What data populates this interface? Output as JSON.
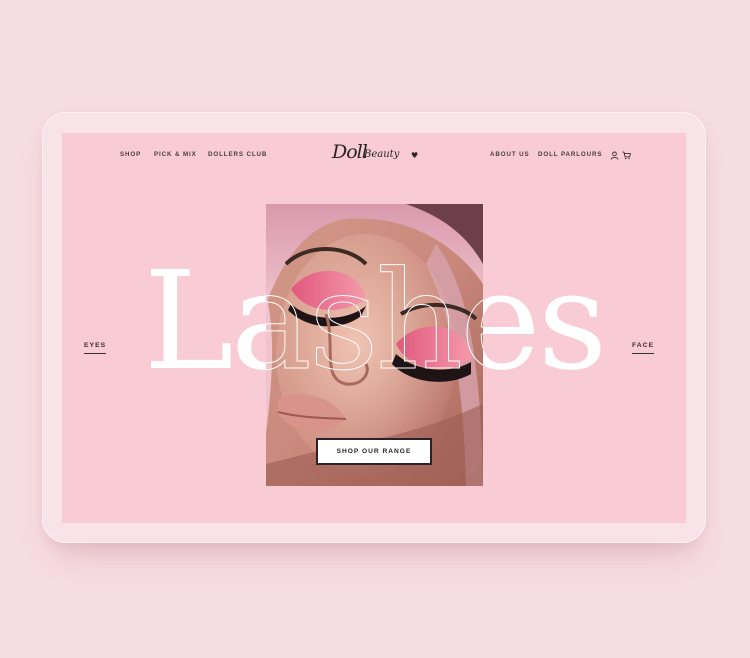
{
  "brand": {
    "logo_big": "Doll",
    "logo_small": "Beauty",
    "heart": "♥"
  },
  "nav": {
    "left": [
      "SHOP",
      "PICK & MIX",
      "DOLLERS CLUB"
    ],
    "right": [
      "ABOUT US",
      "DOLL PARLOURS"
    ],
    "icons": [
      "user-icon",
      "cart-icon"
    ]
  },
  "hero": {
    "word": "Lashes",
    "left_link": "EYES",
    "right_link": "FACE",
    "cta": "SHOP OUR RANGE",
    "image": "model-face-photo"
  },
  "colors": {
    "page_bg": "#f6dde1",
    "screen_bg": "#f8cbd5",
    "text_dark": "#2a2226",
    "accent_pink": "#e8707e"
  }
}
